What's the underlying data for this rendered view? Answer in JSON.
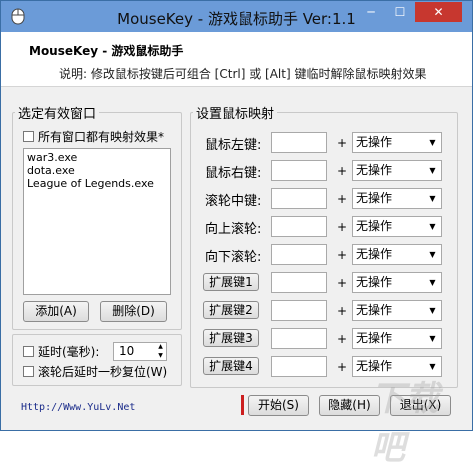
{
  "window": {
    "title": "MouseKey - 游戏鼠标助手 Ver:1.1",
    "minimize_glyph": "─",
    "maximize_glyph": "☐",
    "close_glyph": "✕"
  },
  "header": {
    "title": "MouseKey - 游戏鼠标助手",
    "description": "说明: 修改鼠标按键后可组合 [Ctrl] 或 [Alt] 键临时解除鼠标映射效果"
  },
  "left_panel": {
    "legend": "选定有效窗口",
    "all_windows_checkbox": "所有窗口都有映射效果*",
    "window_list": [
      "war3.exe",
      "dota.exe",
      "League of Legends.exe"
    ],
    "add_button": "添加(A)",
    "delete_button": "删除(D)"
  },
  "options": {
    "delay_checkbox": "延时(毫秒):",
    "delay_value": "10",
    "reset_checkbox": "滚轮后延时一秒复位(W)"
  },
  "mapping_panel": {
    "legend": "设置鼠标映射",
    "plus": "+",
    "rows": [
      {
        "label": "鼠标左键:",
        "action": "无操作"
      },
      {
        "label": "鼠标右键:",
        "action": "无操作"
      },
      {
        "label": "滚轮中键:",
        "action": "无操作"
      },
      {
        "label": "向上滚轮:",
        "action": "无操作"
      },
      {
        "label": "向下滚轮:",
        "action": "无操作"
      },
      {
        "label": "扩展键1",
        "action": "无操作"
      },
      {
        "label": "扩展键2",
        "action": "无操作"
      },
      {
        "label": "扩展键3",
        "action": "无操作"
      },
      {
        "label": "扩展键4",
        "action": "无操作"
      }
    ]
  },
  "footer": {
    "link": "Http://Www.YuLv.Net",
    "start_button": "开始(S)",
    "hide_button": "隐藏(H)",
    "exit_button": "退出(X)"
  },
  "watermark": "下载吧",
  "colors": {
    "titlebar": "#6b9bd8",
    "close": "#c7372f",
    "link": "#1a2b8a",
    "start_marker": "#cc1f1f"
  }
}
